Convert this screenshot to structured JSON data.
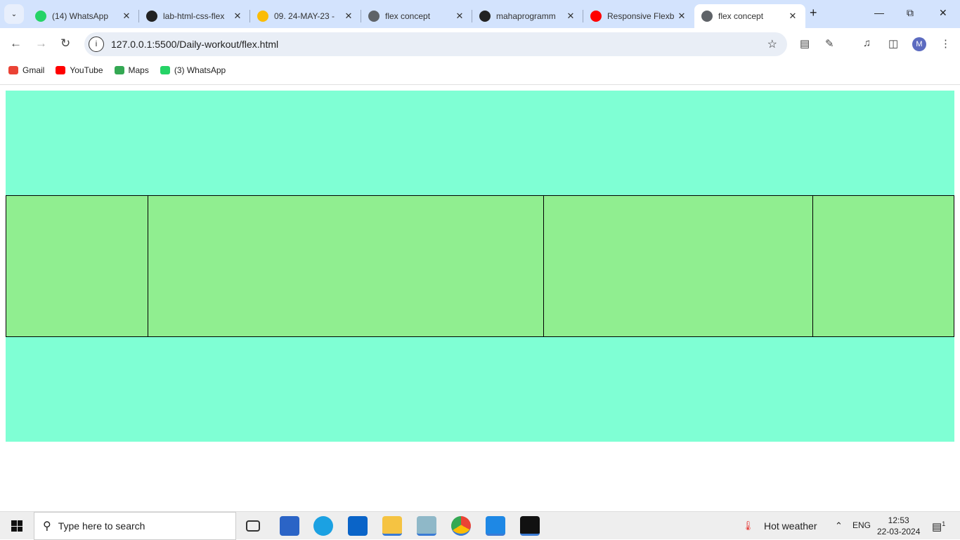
{
  "browser": {
    "tabs": [
      {
        "title": "(14) WhatsApp",
        "icon": "whatsapp-icon",
        "color": "#25d366"
      },
      {
        "title": "lab-html-css-flex",
        "icon": "github-icon",
        "color": "#222222"
      },
      {
        "title": "09. 24-MAY-23 -",
        "icon": "google-drive-icon",
        "color": "#fbbc04"
      },
      {
        "title": "flex concept",
        "icon": "globe-icon",
        "color": "#5f6368"
      },
      {
        "title": "mahaprogramm",
        "icon": "github-icon",
        "color": "#222222"
      },
      {
        "title": "Responsive Flexb",
        "icon": "youtube-icon",
        "color": "#ff0000"
      },
      {
        "title": "flex concept",
        "icon": "globe-icon",
        "color": "#5f6368"
      }
    ],
    "url": "127.0.0.1:5500/Daily-workout/flex.html",
    "profile_initial": "M",
    "bookmarks": [
      {
        "label": "Gmail",
        "color": "#ea4335"
      },
      {
        "label": "YouTube",
        "color": "#ff0000"
      },
      {
        "label": "Maps",
        "color": "#34a853"
      },
      {
        "label": "(3) WhatsApp",
        "color": "#25d366"
      }
    ]
  },
  "page": {
    "container_color": "#7fffd4",
    "box_color": "#90ee90",
    "box_count": 4
  },
  "taskbar": {
    "search_placeholder": "Type here to search",
    "weather": "Hot weather",
    "language": "ENG",
    "time": "12:53",
    "date": "22-03-2024",
    "notifications": "1"
  }
}
